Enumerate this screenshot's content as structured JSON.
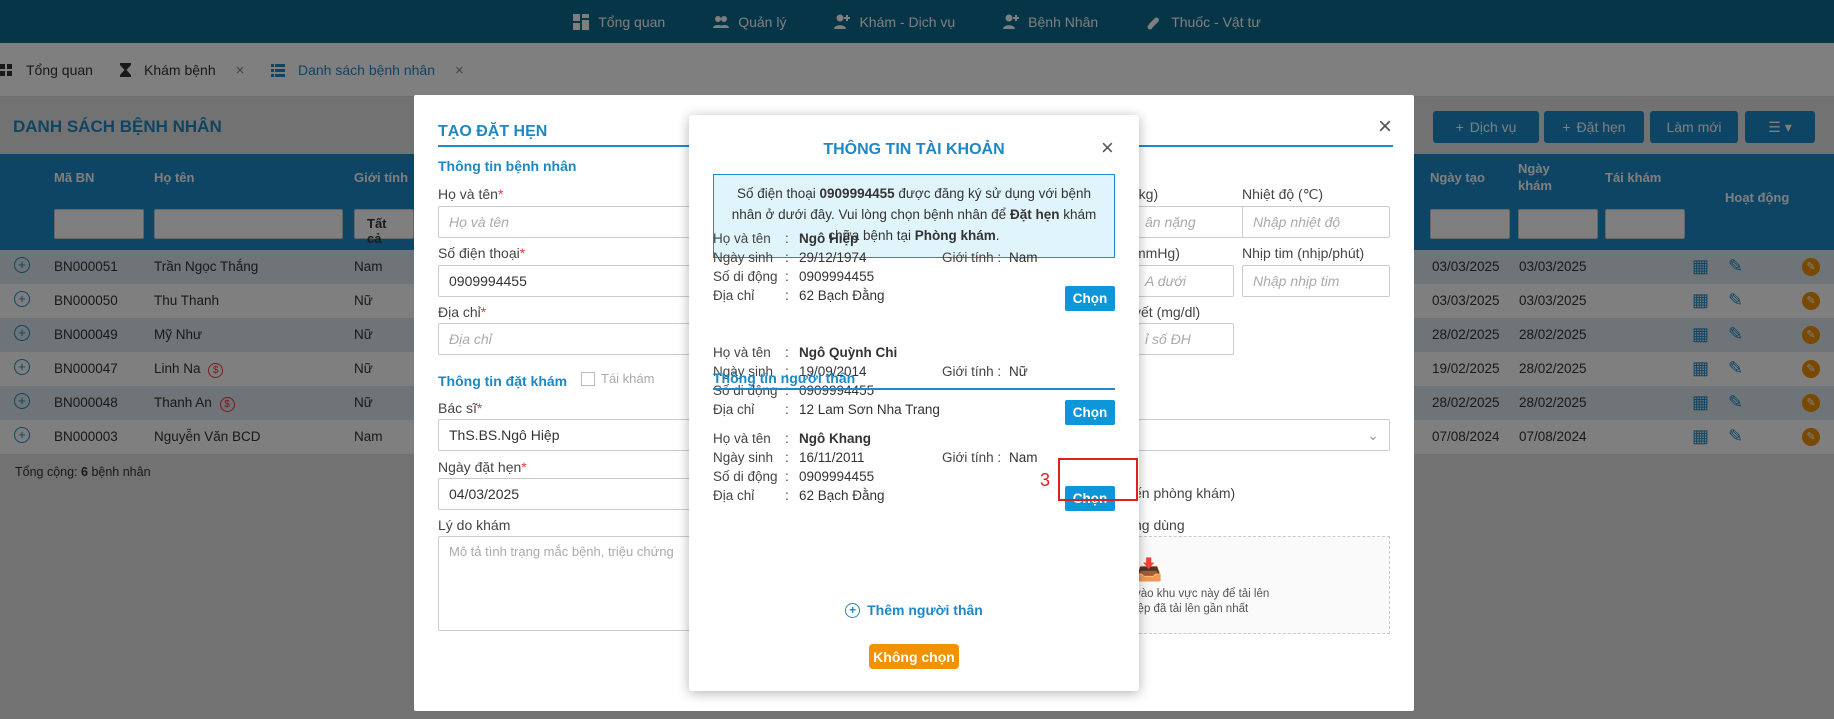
{
  "topnav": {
    "items": [
      {
        "label": "Tổng quan",
        "icon": "dashboard-icon"
      },
      {
        "label": "Quản lý",
        "icon": "users-icon"
      },
      {
        "label": "Khám - Dịch vụ",
        "icon": "user-medical-icon"
      },
      {
        "label": "Bệnh Nhân",
        "icon": "patient-icon"
      },
      {
        "label": "Thuốc - Vật tư",
        "icon": "pill-icon"
      }
    ]
  },
  "tabs": [
    {
      "label": "Tổng quan",
      "icon": "grid-icon"
    },
    {
      "label": "Khám bệnh",
      "icon": "hourglass-icon",
      "close": "×"
    },
    {
      "label": "Danh sách bệnh nhân",
      "icon": "list-icon",
      "close": "×"
    }
  ],
  "page": {
    "title": "DANH SÁCH BỆNH NHÂN",
    "buttons": {
      "service": "Dịch vụ",
      "booking": "Đặt hẹn",
      "refresh": "Làm mới"
    },
    "columns": {
      "ma_bn": "Mã BN",
      "ho_ten": "Họ tên",
      "gioi_tinh": "Giới tính",
      "ngay_tao": "Ngày tạo",
      "ngay_kham": "Ngày khám",
      "tai_kham": "Tái khám",
      "hoat_dong": "Hoạt động"
    },
    "filter_gender": "Tất cả",
    "rows": [
      {
        "ma": "BN000051",
        "ten": "Trần Ngọc Thắng",
        "gt": "Nam",
        "tao": "03/03/2025",
        "kham": "03/03/2025"
      },
      {
        "ma": "BN000050",
        "ten": "Thu Thanh",
        "gt": "Nữ",
        "tao": "03/03/2025",
        "kham": "03/03/2025"
      },
      {
        "ma": "BN000049",
        "ten": "Mỹ Như",
        "gt": "Nữ",
        "tao": "28/02/2025",
        "kham": "28/02/2025"
      },
      {
        "ma": "BN000047",
        "ten": "Linh Na",
        "gt": "Nữ",
        "tao": "19/02/2025",
        "kham": "28/02/2025",
        "badge": "$"
      },
      {
        "ma": "BN000048",
        "ten": "Thanh An",
        "gt": "Nữ",
        "tao": "28/02/2025",
        "kham": "28/02/2025",
        "badge": "$"
      },
      {
        "ma": "BN000003",
        "ten": "Nguyễn Văn BCD",
        "gt": "Nam",
        "tao": "07/08/2024",
        "kham": "07/08/2024"
      }
    ],
    "total_prefix": "Tổng cộng: ",
    "total_count": "6",
    "total_suffix": " bệnh nhân"
  },
  "booking": {
    "title": "TẠO ĐẶT HẸN",
    "patient_section": "Thông tin bệnh nhân",
    "name_label": "Họ và tên",
    "name_placeholder": "Họ và tên",
    "phone_label": "Số điện thoại",
    "phone_value": "0909994455",
    "address_label": "Địa chỉ",
    "address_placeholder": "Địa chỉ",
    "weight_label": "(kg)",
    "weight_placeholder": "ân nặng",
    "temp_label": "Nhiệt độ (℃)",
    "temp_placeholder": "Nhập nhiệt độ",
    "bp_label": "mmHg)",
    "bp_placeholder": "A dưới",
    "pulse_label": "Nhịp tim (nhịp/phút)",
    "pulse_placeholder": "Nhập nhịp tim",
    "sugar_label": "yết (mg/dl)",
    "sugar_placeholder": "ỉ số ĐH",
    "exam_section": "Thông tin đặt khám",
    "revisit": "Tái khám",
    "doctor_label": "Bác sĩ",
    "doctor_value": "ThS.BS.Ngô Hiệp",
    "date_label": "Ngày đặt hẹn",
    "date_value": "04/03/2025",
    "reason_label": "Lý do khám",
    "reason_placeholder": "Mô tả tình trạng mắc bệnh, triệu chứng",
    "clinic_note": "ến phòng khám)",
    "upload_label": "ng dùng",
    "upload_text1": "vào khu vực này để tải lên",
    "upload_text2": "iệp đã tải lên gần nhất"
  },
  "account": {
    "title": "THÔNG TIN TÀI KHOẢN",
    "close": "×",
    "info": {
      "p1": "Số điện thoại ",
      "phone": "0909994455",
      "p2": " được đăng ký sử dụng với bệnh nhân ở dưới đây. Vui lòng chọn bệnh nhân để ",
      "action": "Đặt hẹn",
      "p3": " khám chữa bệnh tại ",
      "place": "Phòng khám",
      "p4": "."
    },
    "labels": {
      "name": "Họ và tên",
      "dob": "Ngày sinh",
      "mobile": "Số di động",
      "address": "Địa chỉ",
      "gender": "Giới tính :",
      "sep": ":"
    },
    "select_label": "Chọn",
    "primary": {
      "name": "Ngô Hiệp",
      "dob": "29/12/1974",
      "mobile": "0909994455",
      "address": "62 Bạch Đằng",
      "gender": "Nam"
    },
    "relatives_title": "Thông tin người thân",
    "relatives": [
      {
        "name": "Ngô Quỳnh Chi",
        "dob": "19/09/2014",
        "mobile": "0909994455",
        "address": "12 Lam Sơn Nha Trang",
        "gender": "Nữ"
      },
      {
        "name": "Ngô Khang",
        "dob": "16/11/2011",
        "mobile": "0909994455",
        "address": "62 Bạch Đằng",
        "gender": "Nam"
      }
    ],
    "add_relative": "Thêm người thân",
    "no_choose": "Không chọn"
  },
  "annotation": {
    "marker": "3",
    "color": "#e02020"
  },
  "colors": {
    "primary": "#1c8bc9",
    "nav": "#0c6a8e",
    "orange": "#f39200"
  }
}
